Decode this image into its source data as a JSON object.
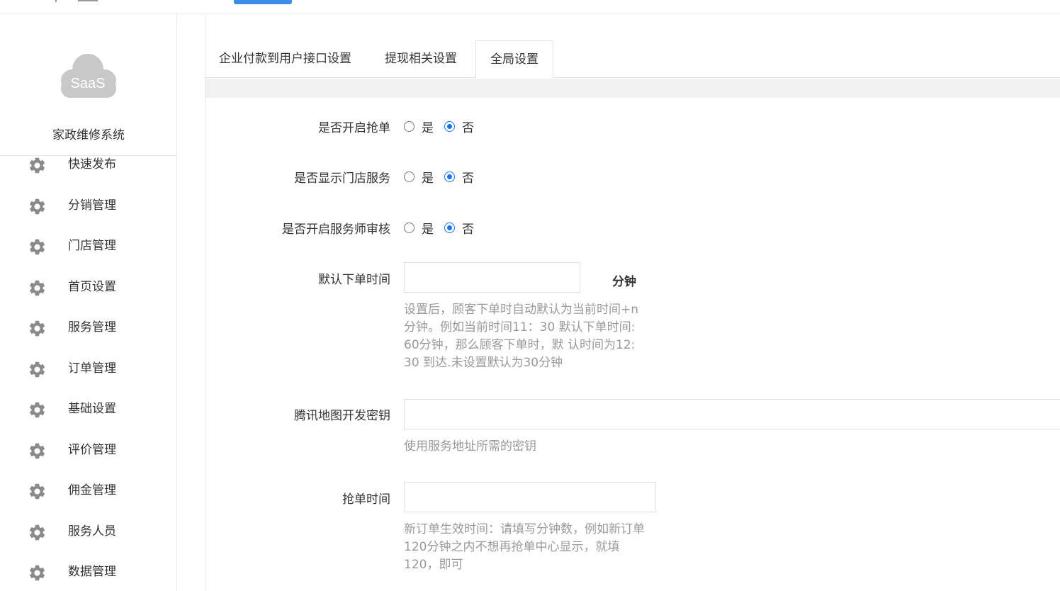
{
  "app": {
    "system_name": "家政维修系统",
    "logo_text": "SaaS"
  },
  "sidebar": {
    "items": [
      {
        "label": "快速发布"
      },
      {
        "label": "分销管理"
      },
      {
        "label": "门店管理"
      },
      {
        "label": "首页设置"
      },
      {
        "label": "服务管理"
      },
      {
        "label": "订单管理"
      },
      {
        "label": "基础设置"
      },
      {
        "label": "评价管理"
      },
      {
        "label": "佣金管理"
      },
      {
        "label": "服务人员"
      },
      {
        "label": "数据管理"
      }
    ]
  },
  "tabs": [
    {
      "label": "企业付款到用户接口设置",
      "active": false
    },
    {
      "label": "提现相关设置",
      "active": false
    },
    {
      "label": "全局设置",
      "active": true
    }
  ],
  "form": {
    "grab_order": {
      "label": "是否开启抢单",
      "yes": "是",
      "no": "否",
      "value": "否"
    },
    "show_store_service": {
      "label": "是否显示门店服务",
      "yes": "是",
      "no": "否",
      "value": "否"
    },
    "server_review": {
      "label": "是否开启服务师审核",
      "yes": "是",
      "no": "否",
      "value": "否"
    },
    "default_order_time": {
      "label": "默认下单时间",
      "value": "",
      "unit": "分钟",
      "hint": [
        "设置后，顾客下单时自动默认为当前时间+n",
        "分钟。例如当前时间11：30 默认下单时间:",
        "60分钟，那么顾客下单时，默 认时间为12:",
        "30 到达.未设置默认为30分钟"
      ]
    },
    "map_key": {
      "label": "腾讯地图开发密钥",
      "value": "",
      "hint": "使用服务地址所需的密钥"
    },
    "grab_time": {
      "label": "抢单时间",
      "value": "",
      "hint": [
        "新订单生效时间：请填写分钟数，例如新订单",
        "120分钟之内不想再抢单中心显示，就填",
        "120，即可"
      ]
    }
  },
  "colors": {
    "accent": "#1a73e8",
    "topbar_button": "#3a8ee6",
    "logo_cloud": "#c8c8c8"
  }
}
